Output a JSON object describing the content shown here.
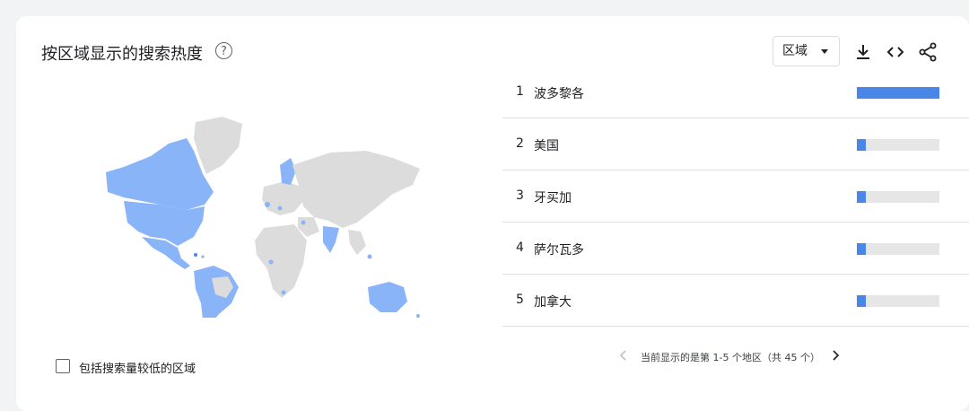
{
  "header": {
    "title": "按区域显示的搜索热度",
    "help_glyph": "?",
    "select_value": "区域"
  },
  "icons": {
    "help": "help-icon",
    "dropdown": "caret-down-icon",
    "download": "download-icon",
    "embed": "embed-code-icon",
    "share": "share-icon",
    "prev": "chevron-left-icon",
    "next": "chevron-right-icon"
  },
  "colors": {
    "bar": "#4a86e8",
    "bar_track": "#e6e6e6",
    "map_high": "#8ab4f8",
    "map_land": "#dcdcdc"
  },
  "rows": [
    {
      "rank": "1",
      "name": "波多黎各",
      "value": "100",
      "fraction": 1.0
    },
    {
      "rank": "2",
      "name": "美国",
      "value": "11",
      "fraction": 0.11
    },
    {
      "rank": "3",
      "name": "牙买加",
      "value": "11",
      "fraction": 0.11
    },
    {
      "rank": "4",
      "name": "萨尔瓦多",
      "value": "11",
      "fraction": 0.11
    },
    {
      "rank": "5",
      "name": "加拿大",
      "value": "11",
      "fraction": 0.11
    }
  ],
  "pager": {
    "text": "当前显示的是第 1-5 个地区（共 45 个）"
  },
  "checkbox": {
    "label": "包括搜索量较低的区域",
    "checked": false
  }
}
